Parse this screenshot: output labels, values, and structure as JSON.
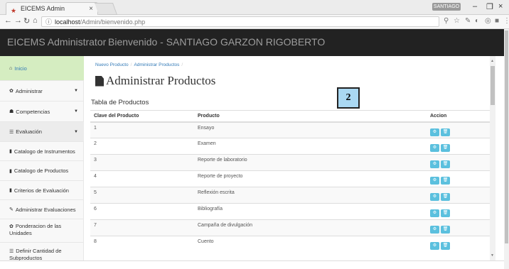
{
  "browser": {
    "tab_title": "EICEMS Admin",
    "tab_close": "×",
    "url_host": "localhost",
    "url_path": "/Admin/bienvenido.php",
    "user_badge": "SANTIAGO",
    "win_min": "–",
    "win_max": "❐",
    "win_close": "×"
  },
  "navbar": {
    "brand": "EICEMS Administrator",
    "welcome": "Bienvenido - SANTIAGO GARZON RIGOBERTO"
  },
  "sidebar": {
    "items": [
      {
        "label": "Inicio"
      },
      {
        "label": "Administrar"
      },
      {
        "label": "Competencias"
      },
      {
        "label": "Evaluación"
      },
      {
        "label": "Catalogo de Instrumentos"
      },
      {
        "label": "Catalogo de Productos"
      },
      {
        "label": "Criterios de Evaluación"
      },
      {
        "label": "Administrar Evaluaciones"
      },
      {
        "label": "Ponderacion de las Unidades"
      },
      {
        "label": "Definir Cantidad de Subproductos"
      }
    ]
  },
  "breadcrumb": {
    "item1": "Nuevo Producto",
    "sep": "/",
    "item2": "Administrar Productos"
  },
  "page": {
    "title": "Administrar Productos",
    "table_label": "Tabla de Productos",
    "overlay_badge": "2"
  },
  "table": {
    "headers": [
      "Clave del Producto",
      "Producto",
      "Accion"
    ],
    "rows": [
      {
        "clave": "1",
        "producto": "Ensayo"
      },
      {
        "clave": "2",
        "producto": "Examen"
      },
      {
        "clave": "3",
        "producto": "Reporte de laboratorio"
      },
      {
        "clave": "4",
        "producto": "Reporte de proyecto"
      },
      {
        "clave": "5",
        "producto": "Reflexión escrita"
      },
      {
        "clave": "6",
        "producto": "Bibliografía"
      },
      {
        "clave": "7",
        "producto": "Campaña de divulgación"
      },
      {
        "clave": "8",
        "producto": "Cuento"
      }
    ]
  },
  "colors": {
    "navbar_bg": "#222222",
    "active_sidebar": "#d5edc1",
    "action_button": "#5bc0de",
    "link": "#337ab7"
  }
}
